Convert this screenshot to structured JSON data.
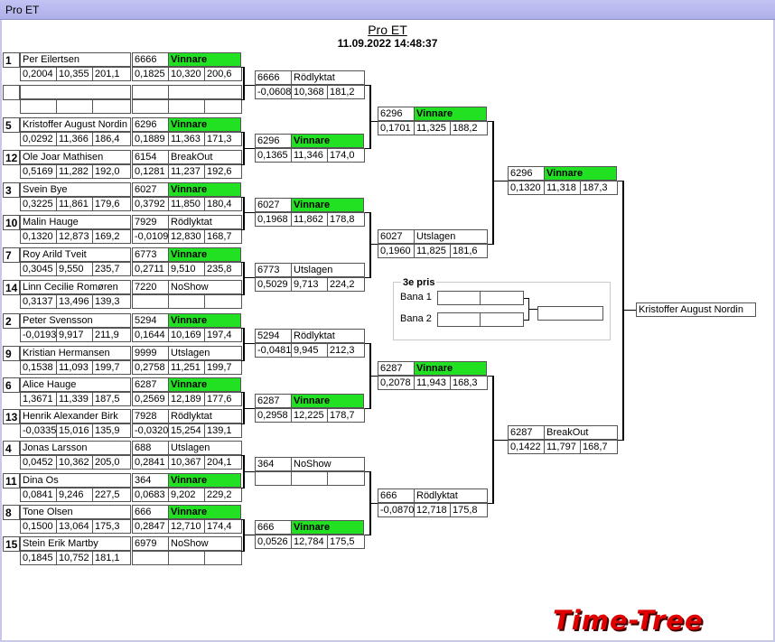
{
  "window": {
    "title": "Pro ET"
  },
  "header": {
    "title": "Pro ET",
    "datetime": "11.09.2022 14:48:37"
  },
  "round1": [
    {
      "seed": "1",
      "name": "Per  Eilertsen",
      "rt": "0,2004",
      "et": "10,355",
      "speed": "201,1",
      "num": "6666",
      "result": "Vinnare",
      "rt2": "0,1825",
      "et2": "10,320",
      "speed2": "200,6",
      "winner": true
    },
    {
      "seed": "",
      "name": "",
      "rt": "",
      "et": "",
      "speed": "",
      "num": "",
      "result": "",
      "rt2": "",
      "et2": "",
      "speed2": "",
      "winner": false
    },
    {
      "seed": "5",
      "name": "Kristoffer August Nordin",
      "rt": "0,0292",
      "et": "11,366",
      "speed": "186,4",
      "num": "6296",
      "result": "Vinnare",
      "rt2": "0,1889",
      "et2": "11,363",
      "speed2": "171,3",
      "winner": true
    },
    {
      "seed": "12",
      "name": "Ole Joar Mathisen",
      "rt": "0,5169",
      "et": "11,282",
      "speed": "192,0",
      "num": "6154",
      "result": "BreakOut",
      "rt2": "0,1281",
      "et2": "11,237",
      "speed2": "192,6",
      "winner": false
    },
    {
      "seed": "3",
      "name": "Svein Bye",
      "rt": "0,3225",
      "et": "11,861",
      "speed": "179,6",
      "num": "6027",
      "result": "Vinnare",
      "rt2": "0,3792",
      "et2": "11,850",
      "speed2": "180,4",
      "winner": true
    },
    {
      "seed": "10",
      "name": "Malin  Hauge",
      "rt": "0,1320",
      "et": "12,873",
      "speed": "169,2",
      "num": "7929",
      "result": "Rödlyktat",
      "rt2": "-0,0109",
      "et2": "12,830",
      "speed2": "168,7",
      "winner": false
    },
    {
      "seed": "7",
      "name": "Roy Arild Tveit",
      "rt": "0,3045",
      "et": "9,550",
      "speed": "235,7",
      "num": "6773",
      "result": "Vinnare",
      "rt2": "0,2711",
      "et2": "9,510",
      "speed2": "235,8",
      "winner": true
    },
    {
      "seed": "14",
      "name": "Linn Cecilie  Romøren",
      "rt": "0,3137",
      "et": "13,496",
      "speed": "139,3",
      "num": "7220",
      "result": "NoShow",
      "rt2": "",
      "et2": "",
      "speed2": "",
      "winner": false
    },
    {
      "seed": "2",
      "name": "Peter Svensson",
      "rt": "-0,0193",
      "et": "9,917",
      "speed": "211,9",
      "num": "5294",
      "result": "Vinnare",
      "rt2": "0,1644",
      "et2": "10,169",
      "speed2": "197,4",
      "winner": true
    },
    {
      "seed": "9",
      "name": "Kristian Hermansen",
      "rt": "0,1538",
      "et": "11,093",
      "speed": "199,7",
      "num": "9999",
      "result": "Utslagen",
      "rt2": "0,2758",
      "et2": "11,251",
      "speed2": "199,7",
      "winner": false
    },
    {
      "seed": "6",
      "name": "Alice  Hauge",
      "rt": "1,3671",
      "et": "11,339",
      "speed": "187,5",
      "num": "6287",
      "result": "Vinnare",
      "rt2": "0,2569",
      "et2": "12,189",
      "speed2": "177,6",
      "winner": true
    },
    {
      "seed": "13",
      "name": "Henrik Alexander Birk",
      "rt": "-0,0335",
      "et": "15,016",
      "speed": "135,9",
      "num": "7928",
      "result": "Rödlyktat",
      "rt2": "-0,0320",
      "et2": "15,254",
      "speed2": "139,1",
      "winner": false
    },
    {
      "seed": "4",
      "name": "Jonas Larsson",
      "rt": "0,0452",
      "et": "10,362",
      "speed": "205,0",
      "num": "688",
      "result": "Utslagen",
      "rt2": "0,2841",
      "et2": "10,367",
      "speed2": "204,1",
      "winner": false
    },
    {
      "seed": "11",
      "name": "Dina Os",
      "rt": "0,0841",
      "et": "9,246",
      "speed": "227,5",
      "num": "364",
      "result": "Vinnare",
      "rt2": "0,0683",
      "et2": "9,202",
      "speed2": "229,2",
      "winner": true
    },
    {
      "seed": "8",
      "name": "Tone Olsen",
      "rt": "0,1500",
      "et": "13,064",
      "speed": "175,3",
      "num": "666",
      "result": "Vinnare",
      "rt2": "0,2847",
      "et2": "12,710",
      "speed2": "174,4",
      "winner": true
    },
    {
      "seed": "15",
      "name": "Stein Erik Martby",
      "rt": "0,1845",
      "et": "10,752",
      "speed": "181,1",
      "num": "6979",
      "result": "NoShow",
      "rt2": "",
      "et2": "",
      "speed2": "",
      "winner": false
    }
  ],
  "round2": [
    {
      "num": "6666",
      "result": "Rödlyktat",
      "rt": "-0,0608",
      "et": "10,368",
      "speed": "181,2",
      "winner": false
    },
    {
      "num": "6296",
      "result": "Vinnare",
      "rt": "0,1365",
      "et": "11,346",
      "speed": "174,0",
      "winner": true
    },
    {
      "num": "6027",
      "result": "Vinnare",
      "rt": "0,1968",
      "et": "11,862",
      "speed": "178,8",
      "winner": true
    },
    {
      "num": "6773",
      "result": "Utslagen",
      "rt": "0,5029",
      "et": "9,713",
      "speed": "224,2",
      "winner": false
    },
    {
      "num": "5294",
      "result": "Rödlyktat",
      "rt": "-0,0481",
      "et": "9,945",
      "speed": "212,3",
      "winner": false
    },
    {
      "num": "6287",
      "result": "Vinnare",
      "rt": "0,2958",
      "et": "12,225",
      "speed": "178,7",
      "winner": true
    },
    {
      "num": "364",
      "result": "NoShow",
      "rt": "",
      "et": "",
      "speed": "",
      "winner": false
    },
    {
      "num": "666",
      "result": "Vinnare",
      "rt": "0,0526",
      "et": "12,784",
      "speed": "175,5",
      "winner": true
    }
  ],
  "round3": [
    {
      "num": "6296",
      "result": "Vinnare",
      "rt": "0,1701",
      "et": "11,325",
      "speed": "188,2",
      "winner": true
    },
    {
      "num": "6027",
      "result": "Utslagen",
      "rt": "0,1960",
      "et": "11,825",
      "speed": "181,6",
      "winner": false
    },
    {
      "num": "6287",
      "result": "Vinnare",
      "rt": "0,2078",
      "et": "11,943",
      "speed": "168,3",
      "winner": true
    },
    {
      "num": "666",
      "result": "Rödlyktat",
      "rt": "-0,0870",
      "et": "12,718",
      "speed": "175,8",
      "winner": false
    }
  ],
  "round4": [
    {
      "num": "6296",
      "result": "Vinnare",
      "rt": "0,1320",
      "et": "11,318",
      "speed": "187,3",
      "winner": true
    },
    {
      "num": "6287",
      "result": "BreakOut",
      "rt": "0,1422",
      "et": "11,797",
      "speed": "168,7",
      "winner": false
    }
  ],
  "champion": "Kristoffer August Nordin",
  "third_place": {
    "title": "3e pris",
    "lane1_label": "Bana 1",
    "lane2_label": "Bana 2",
    "lane1": [
      "",
      ""
    ],
    "lane2": [
      "",
      ""
    ],
    "result": ""
  },
  "logo_text": "Time-Tree",
  "colors": {
    "winner": "#22e022",
    "logo": "#e00000",
    "titlebar": "#b4b6ec"
  }
}
